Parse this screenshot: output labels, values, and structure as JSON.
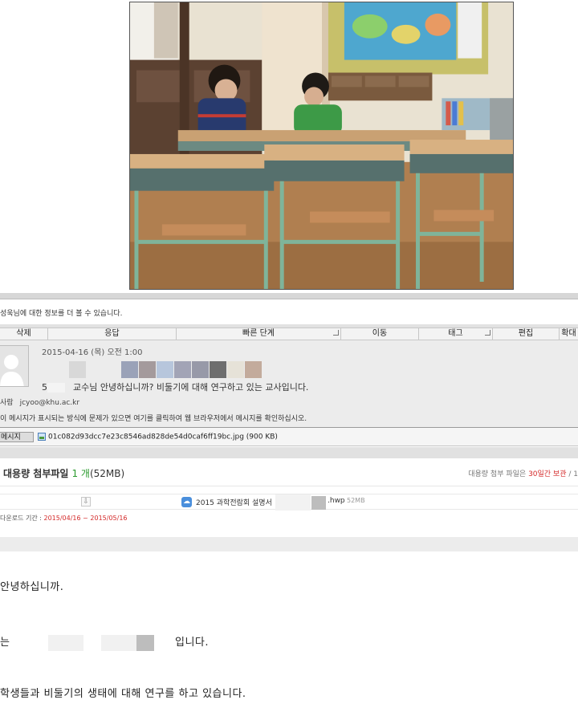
{
  "photo": {
    "alt": "classroom-photo"
  },
  "info_bar": {
    "text": "성욱님에 대한 정보를 더 볼 수 있습니다."
  },
  "ribbon": {
    "groups": [
      {
        "label": "삭제",
        "width": 60
      },
      {
        "label": "응답",
        "width": 160
      },
      {
        "label": "빠른 단계",
        "width": 205,
        "launcher": true
      },
      {
        "label": "이동",
        "width": 97
      },
      {
        "label": "태그",
        "width": 92,
        "launcher": true
      },
      {
        "label": "편집",
        "width": 83
      },
      {
        "label": "확대",
        "width": 23
      }
    ]
  },
  "message": {
    "date": "2015-04-16 (목) 오전 1:00",
    "tile_colors": [
      "#d8d8d8",
      "#ececec",
      "#9aa2b8",
      "#a49a9c",
      "#b7c6dc",
      "#a2a4b6",
      "#9799a8",
      "#6e6e6e",
      "#e6e2d8",
      "#c3ab9c"
    ],
    "subject_prefix": "5",
    "subject": "교수님 안녕하십니까? 비둘기에 대해 연구하고 있는 교사입니다.",
    "recipient_label": "사람",
    "recipient_email": "jcyoo@khu.ac.kr",
    "notice": "이 메시지가 표시되는 방식에 문제가 있으면 여기를 클릭하여 웹 브라우저에서 메시지를 확인하십시오."
  },
  "attachments": {
    "tab_label": "메시지",
    "file": "01c082d93dcc7e23c8546ad828de54d0caf6ff19bc.jpg (900 KB)"
  },
  "large_attachment": {
    "title": "대용량 첨부파일",
    "count": "1 개",
    "size": "(52MB)",
    "keep_prefix": "대용량 첨부 파일은",
    "keep_days": "30일간 보관",
    "keep_suffix": "/ 1",
    "file_name": "2015 과학전람회 설명서",
    "file_ext": ".hwp",
    "file_size": "52MB",
    "period_label": "다운로드 기간 :",
    "period": "2015/04/16 ~ 2015/05/16"
  },
  "body": {
    "line1": "안녕하십니까.",
    "line2_a": "는",
    "line2_b": "입니다.",
    "line3": "학생들과 비둘기의 생태에 대해 연구를 하고 있습니다."
  }
}
